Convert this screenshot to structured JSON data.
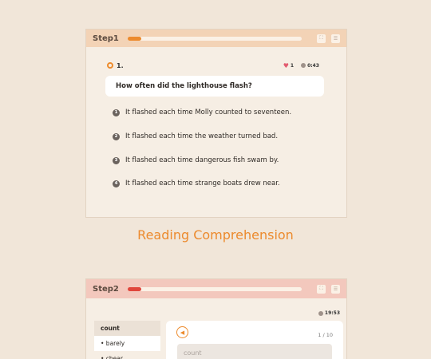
{
  "step1": {
    "title": "Step1",
    "progress": 0.08,
    "progress_color": "#ec8a2d",
    "question_number": "1.",
    "lives": "1",
    "timer": "0:43",
    "question": "How often did the lighthouse flash?",
    "options": [
      {
        "num": "1",
        "text": "It flashed each time Molly counted to seventeen."
      },
      {
        "num": "2",
        "text": "It flashed each time the weather turned bad."
      },
      {
        "num": "3",
        "text": "It flashed each time dangerous fish swam by."
      },
      {
        "num": "4",
        "text": "It flashed each time strange boats drew near."
      }
    ]
  },
  "section_title": "Reading Comprehension",
  "step2": {
    "title": "Step2",
    "progress": 0.08,
    "progress_color": "#e0453b",
    "timer": "19:53",
    "sidebar": {
      "header": "count",
      "items": [
        "• barely",
        "• chear"
      ]
    },
    "page_counter": "1 / 10",
    "input_placeholder": "count"
  }
}
